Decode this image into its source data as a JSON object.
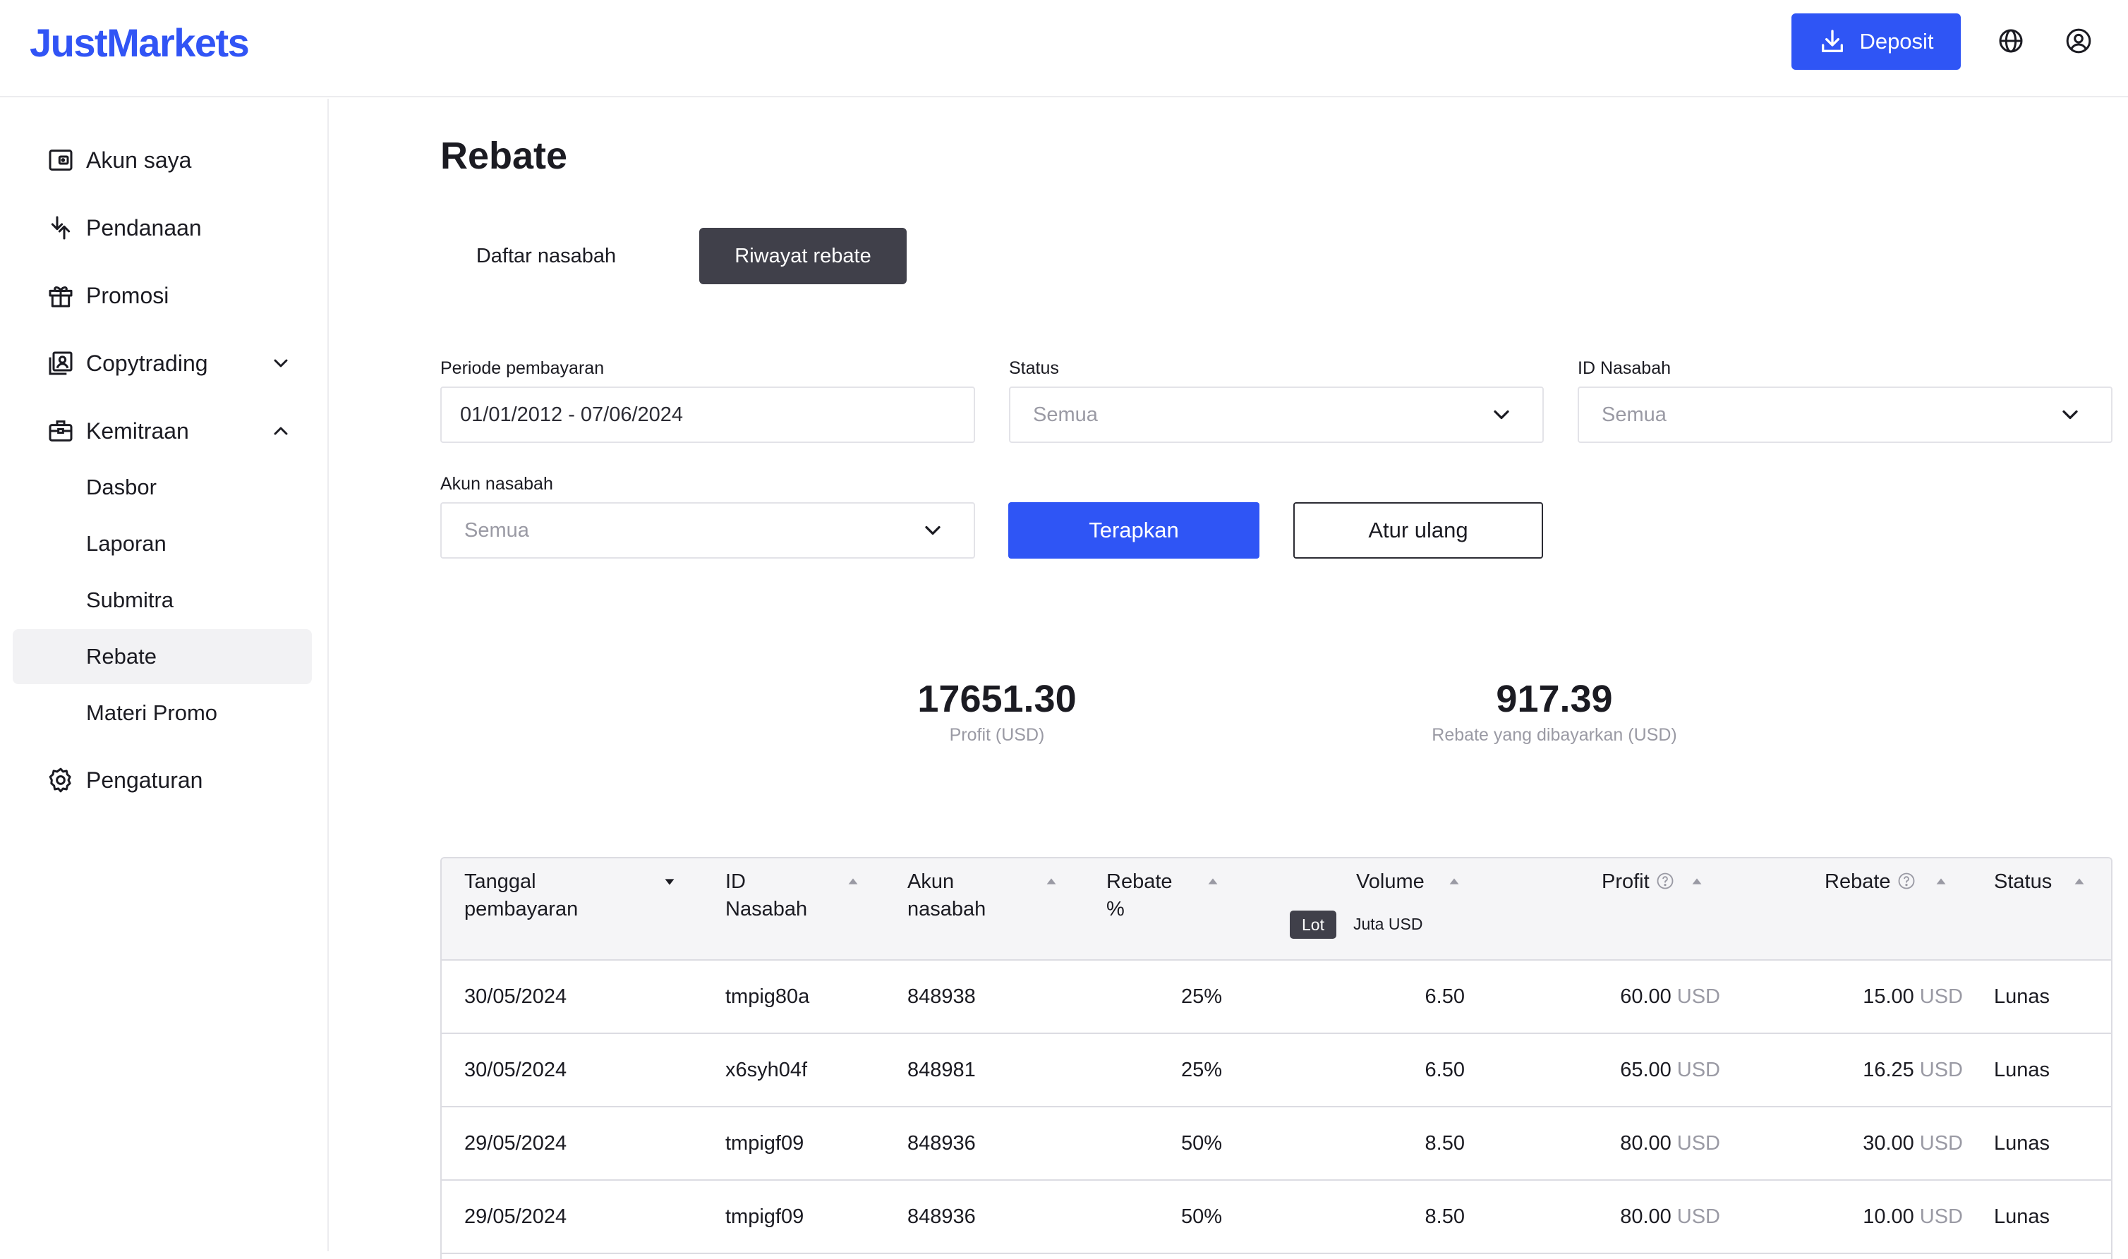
{
  "header": {
    "logo": "JustMarkets",
    "deposit_label": "Deposit",
    "icons": [
      "download-icon",
      "globe-icon",
      "user-circle-icon"
    ]
  },
  "sidebar": {
    "items": [
      {
        "label": "Akun saya",
        "icon": "wallet-icon"
      },
      {
        "label": "Pendanaan",
        "icon": "transfer-arrows-icon"
      },
      {
        "label": "Promosi",
        "icon": "gift-icon"
      },
      {
        "label": "Copytrading",
        "icon": "portrait-icon",
        "expanded": false
      },
      {
        "label": "Kemitraan",
        "icon": "briefcase-icon",
        "expanded": true
      },
      {
        "label": "Pengaturan",
        "icon": "gear-icon"
      }
    ],
    "sub_items": [
      {
        "label": "Dasbor"
      },
      {
        "label": "Laporan"
      },
      {
        "label": "Submitra"
      },
      {
        "label": "Rebate",
        "active": true
      },
      {
        "label": "Materi Promo"
      }
    ]
  },
  "page": {
    "title": "Rebate",
    "tabs": [
      {
        "label": "Daftar nasabah",
        "active": false
      },
      {
        "label": "Riwayat rebate",
        "active": true
      }
    ]
  },
  "filters": {
    "period": {
      "label": "Periode pembayaran",
      "value": "01/01/2012 - 07/06/2024"
    },
    "status": {
      "label": "Status",
      "placeholder": "Semua"
    },
    "client_id": {
      "label": "ID Nasabah",
      "placeholder": "Semua"
    },
    "client_account": {
      "label": "Akun nasabah",
      "placeholder": "Semua"
    },
    "apply_label": "Terapkan",
    "reset_label": "Atur ulang"
  },
  "stats": {
    "profit": {
      "value": "17651.30",
      "caption": "Profit (USD)"
    },
    "rebate": {
      "value": "917.39",
      "caption": "Rebate yang dibayarkan (USD)"
    }
  },
  "table": {
    "headers": {
      "date": "Tanggal pembayaran",
      "client_id": "ID Nasabah",
      "account": "Akun nasabah",
      "rebate_pct": "Rebate %",
      "volume": "Volume",
      "profit": "Profit",
      "rebate": "Rebate",
      "status": "Status"
    },
    "volume_units": {
      "lot": "Lot",
      "juta": "Juta USD",
      "active": "Lot"
    },
    "currency": "USD",
    "rows": [
      {
        "date": "30/05/2024",
        "client_id": "tmpig80a",
        "account": "848938",
        "rebate_pct": "25%",
        "volume": "6.50",
        "profit": "60.00",
        "rebate": "15.00",
        "status": "Lunas"
      },
      {
        "date": "30/05/2024",
        "client_id": "x6syh04f",
        "account": "848981",
        "rebate_pct": "25%",
        "volume": "6.50",
        "profit": "65.00",
        "rebate": "16.25",
        "status": "Lunas"
      },
      {
        "date": "29/05/2024",
        "client_id": "tmpigf09",
        "account": "848936",
        "rebate_pct": "50%",
        "volume": "8.50",
        "profit": "80.00",
        "rebate": "30.00",
        "status": "Lunas"
      },
      {
        "date": "29/05/2024",
        "client_id": "tmpigf09",
        "account": "848936",
        "rebate_pct": "50%",
        "volume": "8.50",
        "profit": "80.00",
        "rebate": "10.00",
        "status": "Lunas"
      }
    ]
  }
}
